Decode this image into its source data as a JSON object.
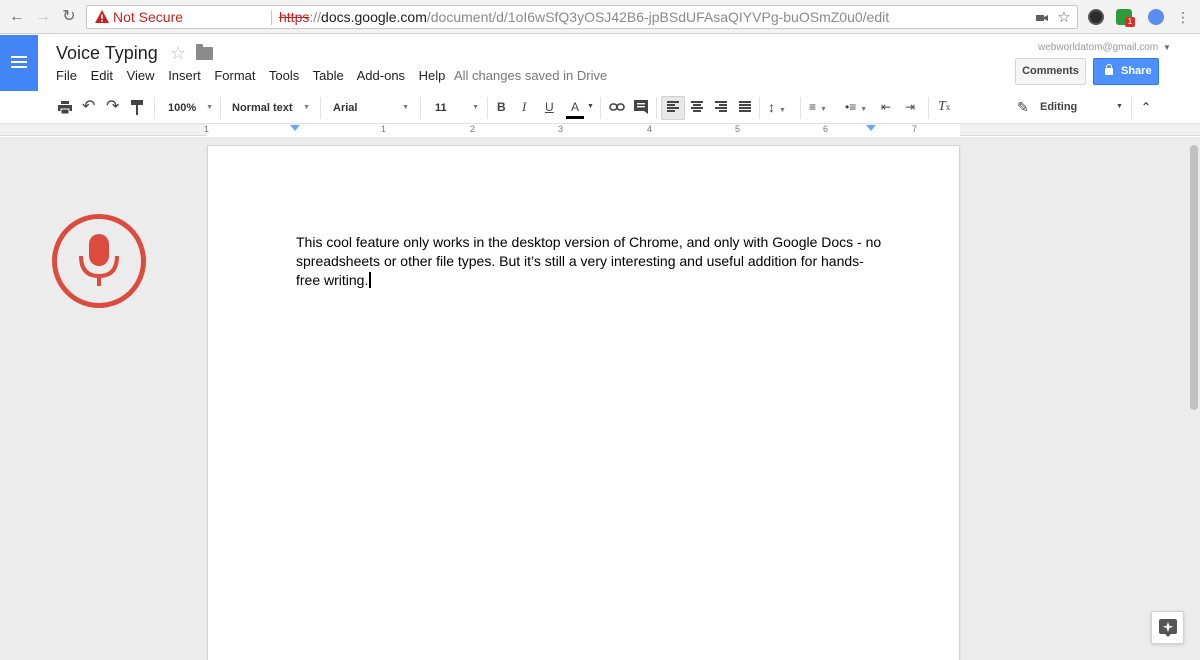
{
  "browser": {
    "security_label": "Not Secure",
    "url_scheme": "https",
    "url_sep": "://",
    "url_host": "docs.google.com",
    "url_path": "/document/d/1oI6wSfQ3yOSJ42B6-jpBSdUFAsaQIYVPg-buOSmZ0u0/edit",
    "extension_badge": "1"
  },
  "header": {
    "doc_title": "Voice Typing",
    "menu": [
      "File",
      "Edit",
      "View",
      "Insert",
      "Format",
      "Tools",
      "Table",
      "Add-ons",
      "Help"
    ],
    "save_status": "All changes saved in Drive",
    "account_email": "webworldatom@gmail.com",
    "comments_label": "Comments",
    "share_label": "Share"
  },
  "toolbar": {
    "zoom": "100%",
    "style": "Normal text",
    "font": "Arial",
    "font_size": "11",
    "bold": "B",
    "italic": "I",
    "underline": "U",
    "text_color": "A",
    "mode": "Editing"
  },
  "ruler": {
    "numbers": [
      "1",
      "1",
      "2",
      "3",
      "4",
      "5",
      "6",
      "7"
    ]
  },
  "document": {
    "body": "This cool feature only works in the desktop version of Chrome, and only with Google Docs - no spreadsheets or other file types. But it’s still a very interesting and useful addition for hands-free writing."
  },
  "colors": {
    "docs_blue": "#4285f4",
    "share_blue": "#4d90fe",
    "mic_red": "#db4c3f",
    "insecure_red": "#c5221f"
  }
}
